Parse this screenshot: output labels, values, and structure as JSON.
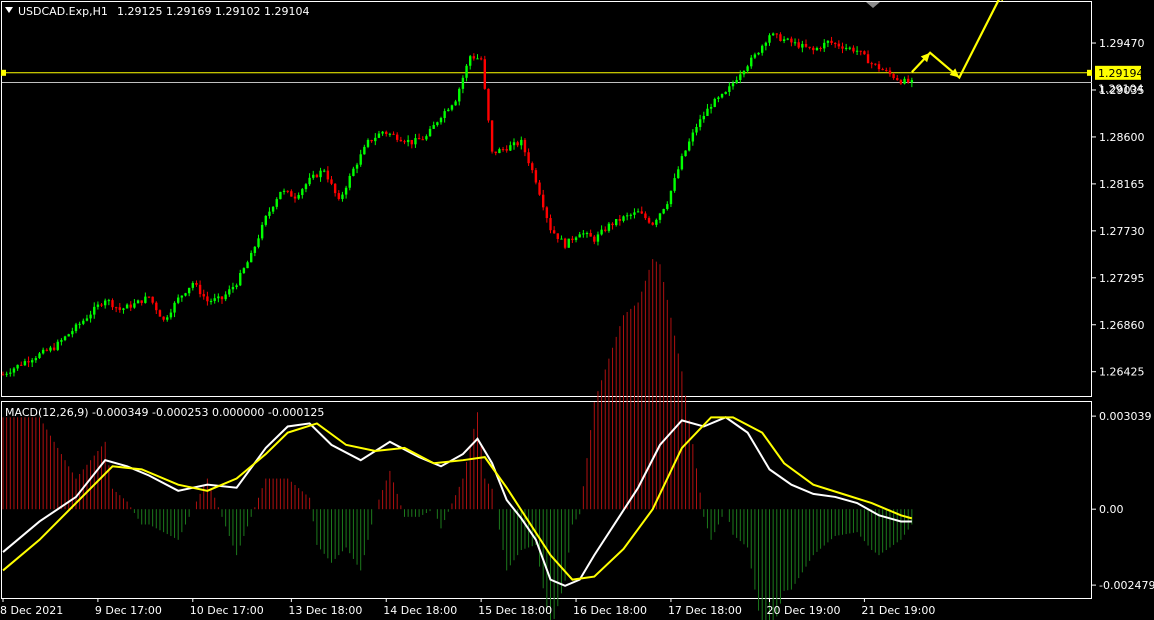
{
  "chart_data": [
    {
      "type": "candlestick",
      "header": {
        "symbol_label": "USDCAD.Exp,H1",
        "ohlc_text": "1.29125 1.29169 1.29102 1.29104"
      },
      "y_ticks": [
        1.2947,
        1.29035,
        1.286,
        1.28165,
        1.2773,
        1.27295,
        1.2686,
        1.26425
      ],
      "y_tick_labels": [
        "1.29470",
        "1.29035",
        "1.28600",
        "1.28165",
        "1.27730",
        "1.27295",
        "1.26860",
        "1.26425"
      ],
      "ylim": [
        1.262,
        1.2985
      ],
      "x_tick_labels": [
        "8 Dec 2021",
        "9 Dec 17:00",
        "10 Dec 17:00",
        "13 Dec 18:00",
        "14 Dec 18:00",
        "15 Dec 18:00",
        "16 Dec 18:00",
        "17 Dec 18:00",
        "20 Dec 19:00",
        "21 Dec 19:00"
      ],
      "x_tick_index": [
        0,
        26,
        52,
        79,
        105,
        131,
        157,
        183,
        210,
        236
      ],
      "close_trend": [
        [
          0,
          1.264
        ],
        [
          6,
          1.2652
        ],
        [
          14,
          1.2665
        ],
        [
          22,
          1.269
        ],
        [
          28,
          1.271
        ],
        [
          32,
          1.27
        ],
        [
          36,
          1.2705
        ],
        [
          40,
          1.2712
        ],
        [
          44,
          1.269
        ],
        [
          48,
          1.271
        ],
        [
          52,
          1.2725
        ],
        [
          56,
          1.2708
        ],
        [
          60,
          1.271
        ],
        [
          64,
          1.2725
        ],
        [
          68,
          1.275
        ],
        [
          72,
          1.2785
        ],
        [
          76,
          1.281
        ],
        [
          80,
          1.2805
        ],
        [
          84,
          1.282
        ],
        [
          88,
          1.283
        ],
        [
          92,
          1.28
        ],
        [
          96,
          1.283
        ],
        [
          100,
          1.2855
        ],
        [
          104,
          1.2865
        ],
        [
          108,
          1.286
        ],
        [
          112,
          1.2855
        ],
        [
          116,
          1.286
        ],
        [
          120,
          1.288
        ],
        [
          124,
          1.2895
        ],
        [
          128,
          1.2935
        ],
        [
          131,
          1.2932
        ],
        [
          134,
          1.2845
        ],
        [
          138,
          1.285
        ],
        [
          142,
          1.2855
        ],
        [
          146,
          1.282
        ],
        [
          150,
          1.2775
        ],
        [
          154,
          1.276
        ],
        [
          158,
          1.2772
        ],
        [
          162,
          1.2765
        ],
        [
          166,
          1.2778
        ],
        [
          170,
          1.2785
        ],
        [
          174,
          1.279
        ],
        [
          178,
          1.278
        ],
        [
          182,
          1.28
        ],
        [
          186,
          1.284
        ],
        [
          190,
          1.287
        ],
        [
          194,
          1.289
        ],
        [
          198,
          1.29
        ],
        [
          202,
          1.292
        ],
        [
          206,
          1.2935
        ],
        [
          210,
          1.2955
        ],
        [
          214,
          1.295
        ],
        [
          218,
          1.2945
        ],
        [
          222,
          1.294
        ],
        [
          226,
          1.2948
        ],
        [
          230,
          1.2944
        ],
        [
          234,
          1.294
        ],
        [
          238,
          1.2928
        ],
        [
          242,
          1.292
        ],
        [
          246,
          1.2912
        ],
        [
          249,
          1.291
        ]
      ],
      "horizontal_lines": [
        {
          "price": 1.29194,
          "label": "1.29194",
          "color": "#ffff00"
        },
        {
          "price": 1.29104,
          "label": "1.29104",
          "color": "#c0c0c0"
        }
      ],
      "forecast_arrow": [
        [
          249,
          1.292
        ],
        [
          254,
          1.2938
        ],
        [
          262,
          1.2915
        ],
        [
          274,
          1.2995
        ]
      ],
      "colors": {
        "bull": "#00ff00",
        "bear": "#ff0000",
        "forecast": "#ffff00",
        "frame": "#ffffff"
      }
    },
    {
      "type": "line",
      "title": "MACD(12,26,9) -0.000349 -0.000253 0.000000 -0.000125",
      "y_ticks": [
        0.003039,
        0.0,
        -0.002479
      ],
      "y_tick_labels": [
        "0.003039",
        "0.00",
        "-0.002479"
      ],
      "ylim": [
        -0.0029,
        0.0035
      ],
      "series": [
        {
          "key": "macd",
          "color": "#ffffff",
          "points": [
            [
              0,
              -0.0014
            ],
            [
              10,
              -0.0004
            ],
            [
              20,
              0.0004
            ],
            [
              28,
              0.0016
            ],
            [
              34,
              0.0014
            ],
            [
              40,
              0.0011
            ],
            [
              48,
              0.0006
            ],
            [
              56,
              0.0008
            ],
            [
              64,
              0.0007
            ],
            [
              72,
              0.002
            ],
            [
              78,
              0.0027
            ],
            [
              84,
              0.0028
            ],
            [
              90,
              0.0021
            ],
            [
              98,
              0.0016
            ],
            [
              106,
              0.0022
            ],
            [
              114,
              0.0017
            ],
            [
              120,
              0.0014
            ],
            [
              126,
              0.0018
            ],
            [
              130,
              0.0023
            ],
            [
              134,
              0.0015
            ],
            [
              138,
              0.0003
            ],
            [
              142,
              -0.0003
            ],
            [
              146,
              -0.001
            ],
            [
              150,
              -0.0023
            ],
            [
              154,
              -0.0025
            ],
            [
              158,
              -0.0023
            ],
            [
              162,
              -0.0015
            ],
            [
              168,
              -0.0004
            ],
            [
              174,
              0.0007
            ],
            [
              180,
              0.0021
            ],
            [
              186,
              0.0029
            ],
            [
              192,
              0.0027
            ],
            [
              198,
              0.003
            ],
            [
              204,
              0.0025
            ],
            [
              210,
              0.0013
            ],
            [
              216,
              0.0008
            ],
            [
              222,
              0.0005
            ],
            [
              228,
              0.0004
            ],
            [
              234,
              0.0002
            ],
            [
              240,
              -0.0002
            ],
            [
              246,
              -0.0004
            ],
            [
              249,
              -0.0004
            ]
          ]
        },
        {
          "key": "signal",
          "color": "#ffff00",
          "points": [
            [
              0,
              -0.002
            ],
            [
              10,
              -0.001
            ],
            [
              20,
              0.0002
            ],
            [
              30,
              0.0014
            ],
            [
              38,
              0.0013
            ],
            [
              48,
              0.0008
            ],
            [
              56,
              0.0006
            ],
            [
              64,
              0.001
            ],
            [
              72,
              0.0018
            ],
            [
              78,
              0.0025
            ],
            [
              86,
              0.0028
            ],
            [
              94,
              0.0021
            ],
            [
              102,
              0.0019
            ],
            [
              110,
              0.002
            ],
            [
              118,
              0.0015
            ],
            [
              126,
              0.0016
            ],
            [
              132,
              0.0017
            ],
            [
              138,
              0.0007
            ],
            [
              144,
              -0.0004
            ],
            [
              150,
              -0.0015
            ],
            [
              156,
              -0.0023
            ],
            [
              162,
              -0.0022
            ],
            [
              170,
              -0.0013
            ],
            [
              178,
              0.0
            ],
            [
              186,
              0.002
            ],
            [
              194,
              0.003
            ],
            [
              200,
              0.003
            ],
            [
              208,
              0.0025
            ],
            [
              214,
              0.0015
            ],
            [
              222,
              0.0008
            ],
            [
              230,
              0.0005
            ],
            [
              238,
              0.0002
            ],
            [
              246,
              -0.0002
            ],
            [
              249,
              -0.0003
            ]
          ]
        }
      ]
    }
  ]
}
